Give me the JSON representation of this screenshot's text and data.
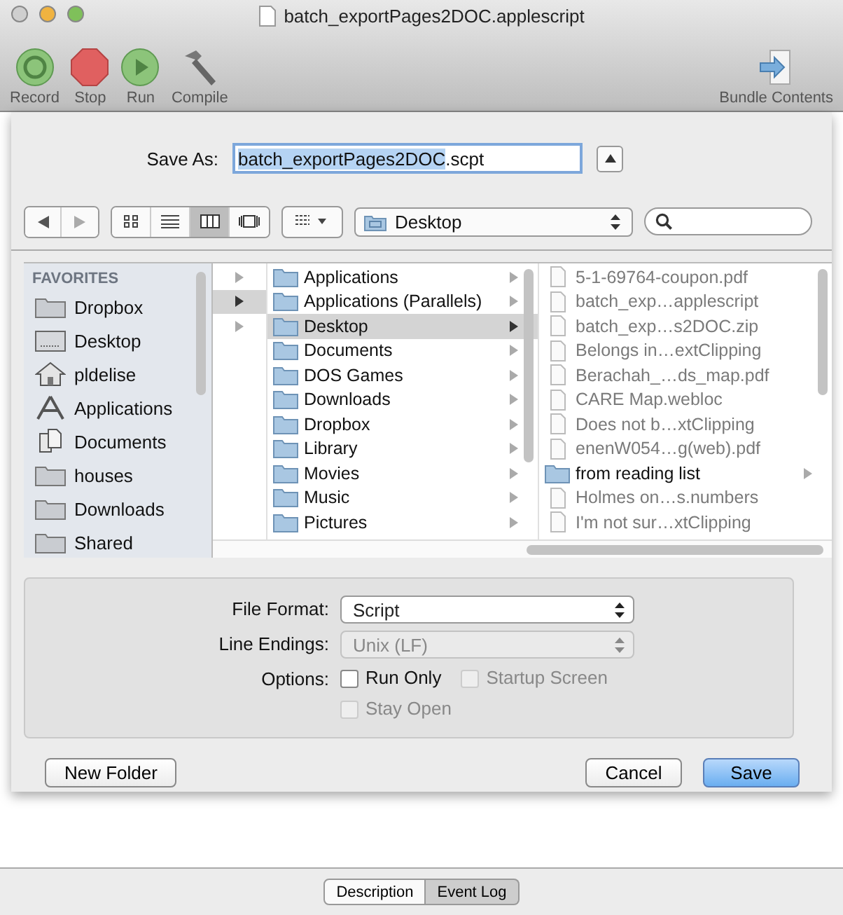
{
  "window": {
    "title": "batch_exportPages2DOC.applescript"
  },
  "toolbar": [
    {
      "label": "Record",
      "kind": "record"
    },
    {
      "label": "Stop",
      "kind": "stop"
    },
    {
      "label": "Run",
      "kind": "run"
    },
    {
      "label": "Compile",
      "kind": "compile"
    },
    {
      "label": "Bundle Contents",
      "kind": "bundle"
    }
  ],
  "save_sheet": {
    "save_as_label": "Save As:",
    "filename": "batch_exportPages2DOC",
    "extension": ".scpt",
    "view_modes": [
      {
        "kind": "icons",
        "selected": false
      },
      {
        "kind": "list",
        "selected": false
      },
      {
        "kind": "columns",
        "selected": true
      },
      {
        "kind": "coverflow",
        "selected": false
      }
    ],
    "location": "Desktop",
    "sidebar": {
      "heading": "FAVORITES",
      "items": [
        {
          "label": "Dropbox",
          "kind": "folder"
        },
        {
          "label": "Desktop",
          "kind": "drive"
        },
        {
          "label": "pldelise",
          "kind": "home"
        },
        {
          "label": "Applications",
          "kind": "apps"
        },
        {
          "label": "Documents",
          "kind": "docs"
        },
        {
          "label": "houses",
          "kind": "folder"
        },
        {
          "label": "Downloads",
          "kind": "folder"
        },
        {
          "label": "Shared",
          "kind": "folder"
        }
      ]
    },
    "column_1": [
      {
        "selected": false
      },
      {
        "selected": true
      },
      {
        "selected": false
      }
    ],
    "column_2": [
      {
        "label": "Applications",
        "selected": false
      },
      {
        "label": "Applications (Parallels)",
        "selected": false
      },
      {
        "label": "Desktop",
        "selected": true
      },
      {
        "label": "Documents",
        "selected": false
      },
      {
        "label": "DOS Games",
        "selected": false
      },
      {
        "label": "Downloads",
        "selected": false
      },
      {
        "label": "Dropbox",
        "selected": false
      },
      {
        "label": "Library",
        "selected": false
      },
      {
        "label": "Movies",
        "selected": false
      },
      {
        "label": "Music",
        "selected": false
      },
      {
        "label": "Pictures",
        "selected": false
      }
    ],
    "column_3": [
      {
        "label": "5-1-69764-coupon.pdf",
        "kind": "document",
        "disabled": true
      },
      {
        "label": "batch_exp…applescript",
        "kind": "document",
        "disabled": true
      },
      {
        "label": "batch_exp…s2DOC.zip",
        "kind": "document",
        "disabled": true
      },
      {
        "label": "Belongs in…extClipping",
        "kind": "document",
        "disabled": true
      },
      {
        "label": "Berachah_…ds_map.pdf",
        "kind": "document",
        "disabled": true
      },
      {
        "label": "CARE Map.webloc",
        "kind": "document",
        "disabled": true
      },
      {
        "label": "Does not b…xtClipping",
        "kind": "document",
        "disabled": true
      },
      {
        "label": "enenW054…g(web).pdf",
        "kind": "document",
        "disabled": true
      },
      {
        "label": "from reading list",
        "kind": "folder",
        "disabled": false
      },
      {
        "label": "Holmes on…s.numbers",
        "kind": "document",
        "disabled": true
      },
      {
        "label": "I'm not sur…xtClipping",
        "kind": "document",
        "disabled": true
      }
    ],
    "file_format": {
      "label": "File Format:",
      "value": "Script",
      "disabled": false
    },
    "line_endings": {
      "label": "Line Endings:",
      "value": "Unix (LF)",
      "disabled": true
    },
    "options_label": "Options:",
    "options": [
      {
        "label": "Run Only",
        "checked": false,
        "disabled": false
      },
      {
        "label": "Startup Screen",
        "checked": false,
        "disabled": true
      },
      {
        "label": "Stay Open",
        "checked": false,
        "disabled": true
      }
    ],
    "buttons": [
      {
        "label": "New Folder",
        "kind": "secondary"
      },
      {
        "label": "Cancel",
        "kind": "secondary"
      },
      {
        "label": "Save",
        "kind": "default"
      }
    ]
  },
  "bottom_tabs": [
    {
      "label": "Description",
      "selected": false
    },
    {
      "label": "Event Log",
      "selected": true
    }
  ]
}
